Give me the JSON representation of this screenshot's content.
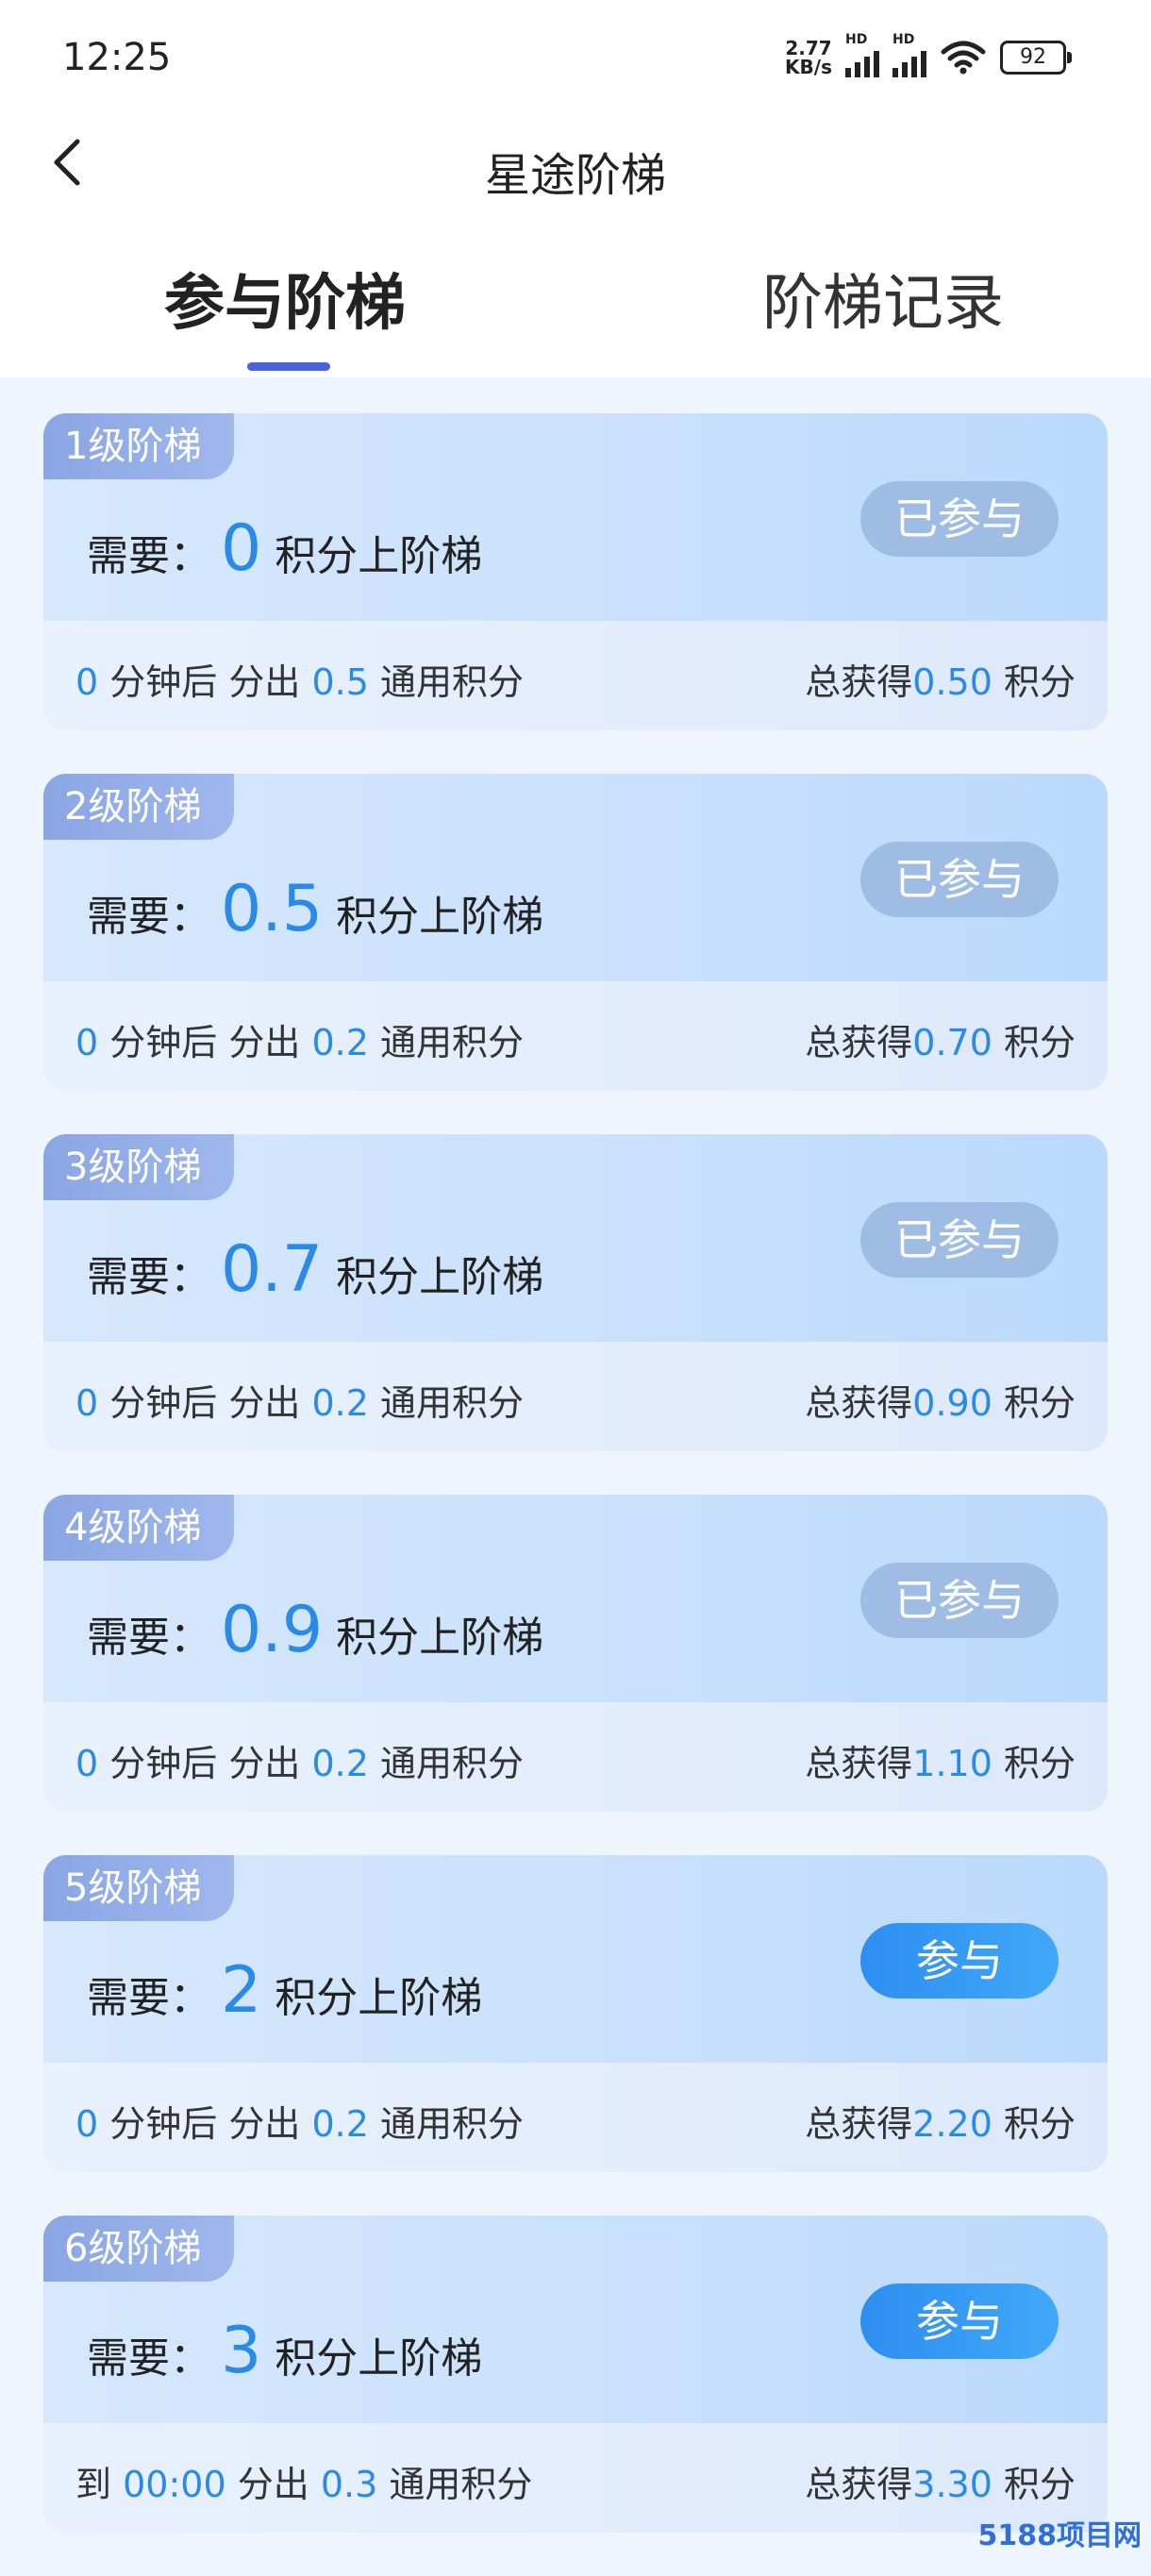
{
  "status_bar": {
    "time": "12:25",
    "net_speed_value": "2.77",
    "net_speed_unit": "KB/s",
    "signal_label": "HD",
    "battery": "92"
  },
  "nav": {
    "title": "星途阶梯"
  },
  "tabs": [
    {
      "label": "参与阶梯",
      "active": true
    },
    {
      "label": "阶梯记录",
      "active": false
    }
  ],
  "labels": {
    "need_prefix": "需要：",
    "need_suffix": "积分上阶梯",
    "minutes_after": "分钟后 分出",
    "general_points": "通用积分",
    "total_prefix": "总获得",
    "points": "积分",
    "to": "到",
    "out": "分出"
  },
  "levels": [
    {
      "badge": "1级阶梯",
      "need": "0",
      "action": "已参与",
      "joined": true,
      "minutes": "0",
      "release": "0.5",
      "total": "0.50"
    },
    {
      "badge": "2级阶梯",
      "need": "0.5",
      "action": "已参与",
      "joined": true,
      "minutes": "0",
      "release": "0.2",
      "total": "0.70"
    },
    {
      "badge": "3级阶梯",
      "need": "0.7",
      "action": "已参与",
      "joined": true,
      "minutes": "0",
      "release": "0.2",
      "total": "0.90"
    },
    {
      "badge": "4级阶梯",
      "need": "0.9",
      "action": "已参与",
      "joined": true,
      "minutes": "0",
      "release": "0.2",
      "total": "1.10"
    },
    {
      "badge": "5级阶梯",
      "need": "2",
      "action": "参与",
      "joined": false,
      "minutes": "0",
      "release": "0.2",
      "total": "2.20"
    },
    {
      "badge": "6级阶梯",
      "need": "3",
      "action": "参与",
      "joined": false,
      "time": "00:00",
      "release": "0.3",
      "total": "3.30"
    }
  ],
  "watermark": "5188项目网",
  "colors": {
    "accent": "#2a8ae8",
    "tab_indicator": "#4a63d6",
    "joined_button": "#9fbde4",
    "badge": "#8aa6e3"
  }
}
